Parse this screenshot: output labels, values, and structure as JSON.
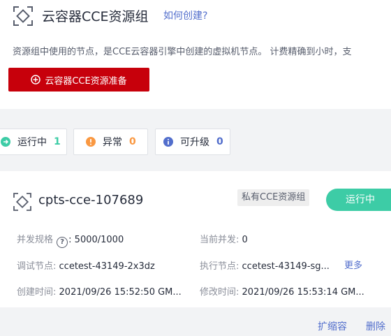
{
  "header": {
    "title": "云容器CCE资源组",
    "help_link": "如何创建?",
    "description": "资源组中使用的节点，是CCE云容器引擎中创建的虚拟机节点。 计费精确到小时，支",
    "prepare_button": "云容器CCE资源准备"
  },
  "filters": [
    {
      "label": "运行中",
      "count": "1",
      "color": "#3dcca6"
    },
    {
      "label": "异常",
      "count": "0",
      "color": "#fa9841"
    },
    {
      "label": "可升级",
      "count": "0",
      "color": "#526ecc"
    }
  ],
  "card": {
    "name": "cpts-cce-107689",
    "tag": "私有CCE资源组",
    "status": "运行中",
    "concurrency_label": "并发规格",
    "concurrency_value": ": 5000/1000",
    "current_label": "当前并发:",
    "current_value": " 0",
    "debug_label": "调试节点:",
    "debug_value": " ccetest-43149-2x3dz",
    "exec_label": "执行节点:",
    "exec_value": " ccetest-43149-sg...",
    "more": "更多",
    "created_label": "创建时间:",
    "created_value": " 2021/09/26 15:52:50 GM...",
    "modified_label": "修改时间:",
    "modified_value": " 2021/09/26 15:53:14 GM..."
  },
  "actions": {
    "scale": "扩缩容",
    "delete": "删除"
  }
}
